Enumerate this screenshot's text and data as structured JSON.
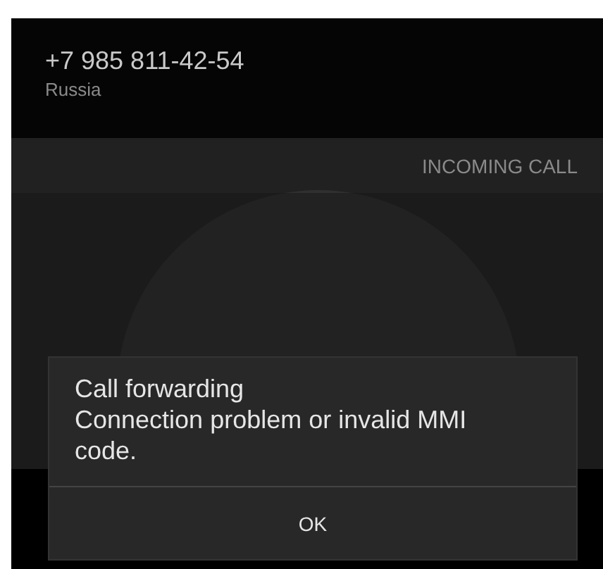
{
  "caller": {
    "number": "+7 985 811-42-54",
    "location": "Russia"
  },
  "call_state": "INCOMING CALL",
  "dialog": {
    "title": "Call forwarding",
    "message": "Connection problem or invalid MMI code.",
    "buttons": [
      "OK"
    ]
  }
}
